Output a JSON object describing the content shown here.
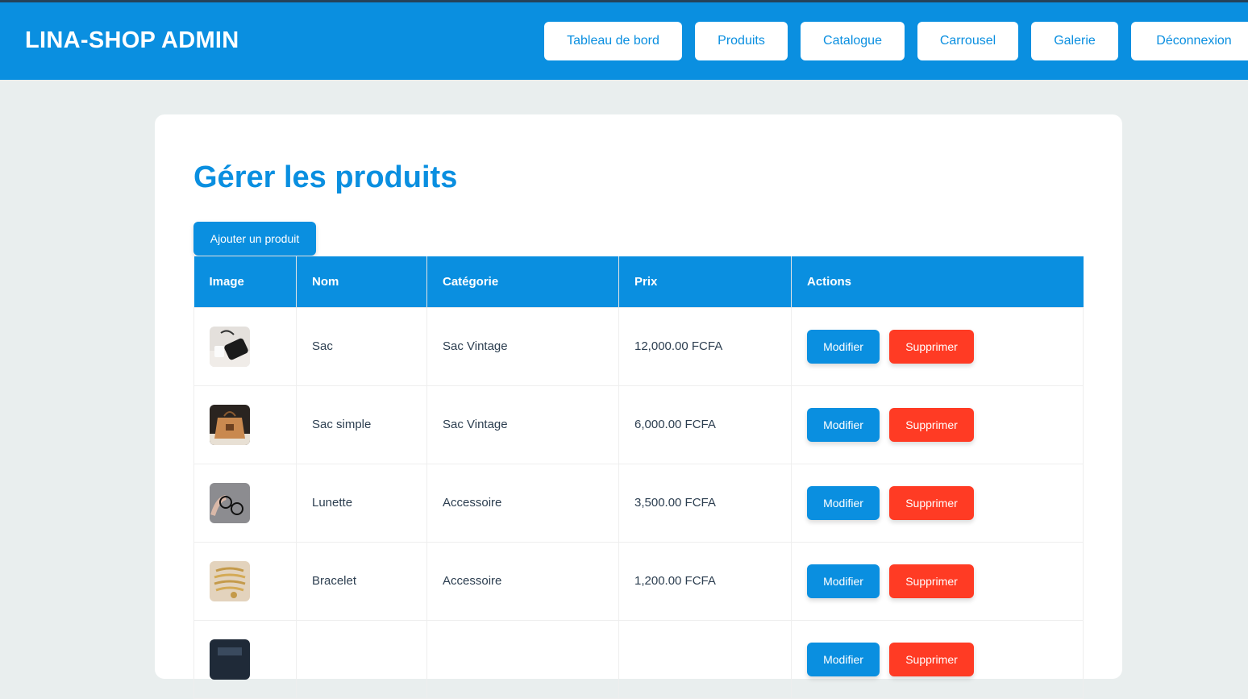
{
  "header": {
    "brand": "LINA-SHOP ADMIN",
    "nav": [
      {
        "label": "Tableau de bord",
        "name": "nav-dashboard"
      },
      {
        "label": "Produits",
        "name": "nav-products"
      },
      {
        "label": "Catalogue",
        "name": "nav-catalogue"
      },
      {
        "label": "Carrousel",
        "name": "nav-carousel"
      },
      {
        "label": "Galerie",
        "name": "nav-gallery"
      },
      {
        "label": "Déconnexion",
        "name": "nav-logout"
      }
    ]
  },
  "main": {
    "title": "Gérer les produits",
    "add_label": "Ajouter un produit",
    "columns": [
      "Image",
      "Nom",
      "Catégorie",
      "Prix",
      "Actions"
    ],
    "edit_label": "Modifier",
    "delete_label": "Supprimer",
    "rows": [
      {
        "image": "black-bag-photo",
        "name": "Sac",
        "category": "Sac Vintage",
        "price": "12,000.00 FCFA"
      },
      {
        "image": "tan-tote-bag-photo",
        "name": "Sac simple",
        "category": "Sac Vintage",
        "price": "6,000.00 FCFA"
      },
      {
        "image": "glasses-photo",
        "name": "Lunette",
        "category": "Accessoire",
        "price": "3,500.00 FCFA"
      },
      {
        "image": "gold-bracelets-photo",
        "name": "Bracelet",
        "category": "Accessoire",
        "price": "1,200.00 FCFA"
      },
      {
        "image": "dark-product-photo",
        "name": "",
        "category": "",
        "price": ""
      }
    ]
  },
  "colors": {
    "accent": "#0a8fe0",
    "danger": "#ff3b24",
    "background": "#e9eeee"
  }
}
